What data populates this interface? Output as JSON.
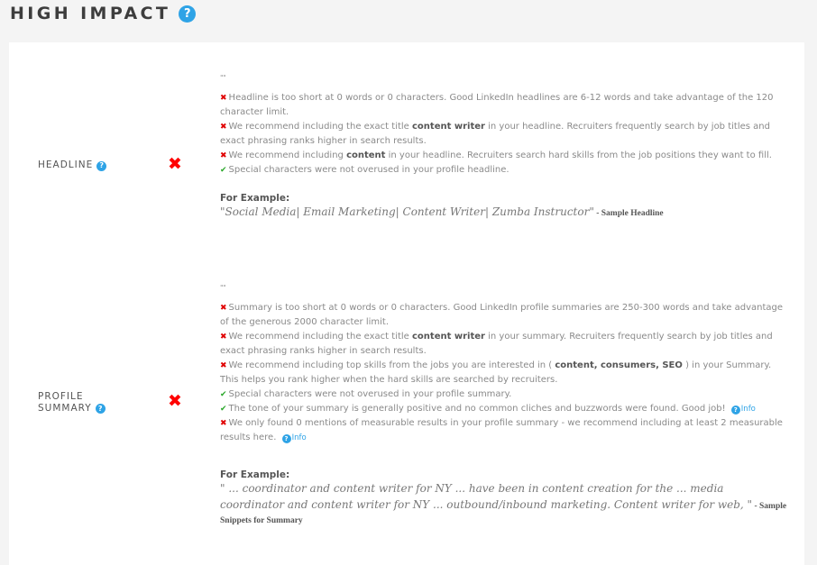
{
  "header": {
    "title": "HIGH IMPACT",
    "help_icon": "question-circle-icon"
  },
  "sections": {
    "headline": {
      "label": "HEADLINE",
      "status": "fail",
      "status_icon": "red-x-icon",
      "quote": "\"\"",
      "items": [
        {
          "status": "fail",
          "text_before": "Headline is too short at 0 words or 0 characters. Good LinkedIn headlines are 6-12 words and take advantage of the 120 character limit.",
          "bold": "",
          "text_after": ""
        },
        {
          "status": "fail",
          "text_before": "We recommend including the exact title ",
          "bold": "content writer",
          "text_after": " in your headline. Recruiters frequently search by job titles and exact phrasing ranks higher in search results."
        },
        {
          "status": "fail",
          "text_before": "We recommend including ",
          "bold": "content",
          "text_after": " in your headline. Recruiters search hard skills from the job positions they want to fill."
        },
        {
          "status": "pass",
          "text_before": "Special characters were not overused in your profile headline.",
          "bold": "",
          "text_after": ""
        }
      ],
      "example_label": "For Example:",
      "example_text": "\"Social Media| Email Marketing| Content Writer| Zumba Instructor\"",
      "example_suffix": " - Sample Headline"
    },
    "summary": {
      "label_line1": "PROFILE",
      "label_line2": "SUMMARY",
      "status": "fail",
      "status_icon": "red-x-icon",
      "quote": "\"\"",
      "items": [
        {
          "status": "fail",
          "text_before": "Summary is too short at 0 words or 0 characters. Good LinkedIn profile summaries are 250-300 words and take advantage of the generous 2000 character limit.",
          "bold": "",
          "text_after": "",
          "info": ""
        },
        {
          "status": "fail",
          "text_before": "We recommend including the exact title ",
          "bold": "content writer",
          "text_after": " in your summary. Recruiters frequently search by job titles and exact phrasing ranks higher in search results.",
          "info": ""
        },
        {
          "status": "fail",
          "text_before": "We recommend including top skills from the jobs you are interested in ( ",
          "bold": "content, consumers, SEO",
          "text_after": " ) in your Summary. This helps you rank higher when the hard skills are searched by recruiters.",
          "info": ""
        },
        {
          "status": "pass",
          "text_before": "Special characters were not overused in your profile summary.",
          "bold": "",
          "text_after": "",
          "info": ""
        },
        {
          "status": "pass",
          "text_before": "The tone of your summary is generally positive and no common cliches and buzzwords were found. Good job! ",
          "bold": "",
          "text_after": "",
          "info": "Info"
        },
        {
          "status": "fail",
          "text_before": "We only found 0 mentions of measurable results in your profile summary - we recommend including at least 2 measurable results here. ",
          "bold": "",
          "text_after": "",
          "info": "Info"
        }
      ],
      "example_label": "For Example:",
      "example_text": "\" ... coordinator and content writer for NY ... have been in content creation for the ... media coordinator and content writer for NY ... outbound/inbound marketing. Content writer for web, \"",
      "example_suffix": " - Sample Snippets for Summary"
    }
  },
  "colors": {
    "accent": "#2ea3e6",
    "fail": "#e00000",
    "pass": "#2aa72a"
  }
}
